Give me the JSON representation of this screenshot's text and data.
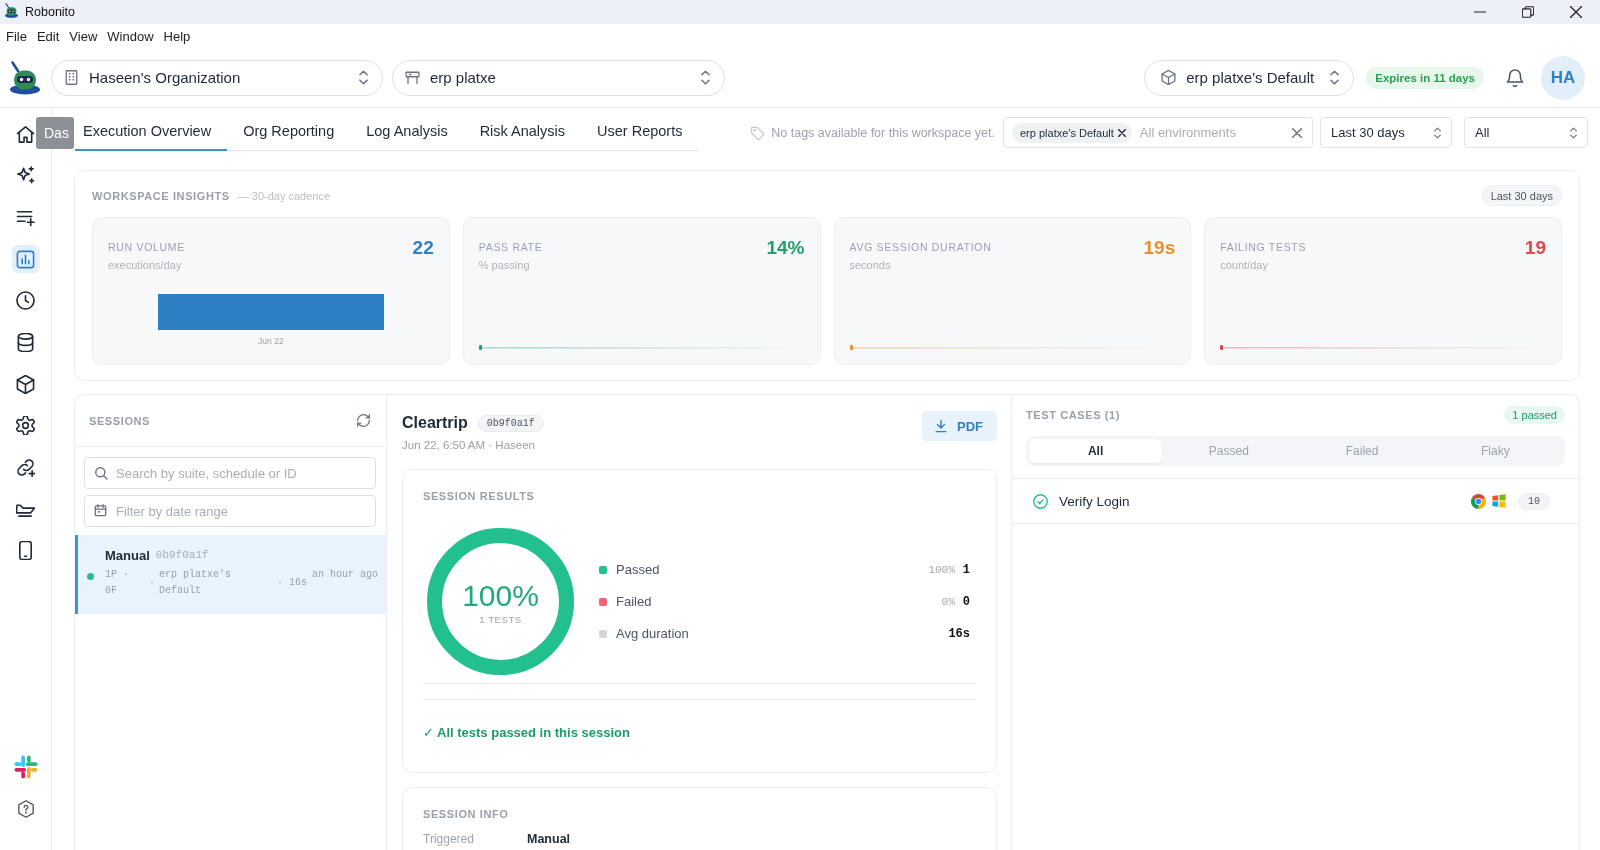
{
  "window": {
    "title": "Robonito"
  },
  "menu": [
    "File",
    "Edit",
    "View",
    "Window",
    "Help"
  ],
  "header": {
    "organization": "Haseen's Organization",
    "project": "erp platxe",
    "environment": "erp platxe's Default",
    "expiry": "Expires in 11 days",
    "avatar": "HA"
  },
  "sidebar": {
    "items": [
      {
        "selected": false
      },
      {
        "selected": false
      },
      {
        "selected": false
      },
      {
        "selected": true
      },
      {
        "selected": false
      },
      {
        "selected": false
      },
      {
        "selected": false
      },
      {
        "selected": false
      },
      {
        "selected": false
      },
      {
        "selected": false
      },
      {
        "selected": false
      }
    ]
  },
  "tooltip": "Das",
  "tabs": [
    {
      "label": "Execution Overview",
      "selected": true
    },
    {
      "label": "Org Reporting",
      "selected": false
    },
    {
      "label": "Log Analysis",
      "selected": false
    },
    {
      "label": "Risk Analysis",
      "selected": false
    },
    {
      "label": "User Reports",
      "selected": false
    }
  ],
  "filters": {
    "tags_note": "No tags available for this workspace yet.",
    "environment_chip": "erp platxe's Default",
    "environment_placeholder": "All environments",
    "date_range": "Last 30 days",
    "status": "All"
  },
  "insights": {
    "title": "WORKSPACE INSIGHTS",
    "subtitle": "— 30-day cadence",
    "range": "Last 30 days",
    "cards": [
      {
        "kind": "bar",
        "label": "RUN VOLUME",
        "unit": "executions/day",
        "value": "22",
        "color": "#2f7fc4",
        "axis_label": "Jun 22"
      },
      {
        "kind": "line",
        "label": "PASS RATE",
        "unit": "% passing",
        "value": "14%",
        "color": "#22a06b"
      },
      {
        "kind": "line",
        "label": "AVG SESSION DURATION",
        "unit": "seconds",
        "value": "19s",
        "color": "#e8912d"
      },
      {
        "kind": "line",
        "label": "FAILING TESTS",
        "unit": "count/day",
        "value": "19",
        "color": "#dc4a4a"
      }
    ]
  },
  "sessions": {
    "title": "SESSIONS",
    "search_placeholder": "Search by suite, schedule or ID",
    "date_placeholder": "Filter by date range",
    "items": [
      {
        "selected": true,
        "passed": true,
        "name": "Manual",
        "id": "0b9f0a1f",
        "meta": [
          "1P · 0F",
          "·",
          "erp platxe's Default",
          "· 16s"
        ],
        "time": "an hour ago"
      }
    ]
  },
  "session": {
    "title": "Cleartrip",
    "id": "0b9f0a1f",
    "subtitle": "Jun 22, 6:50 AM · Haseen",
    "export_label": "PDF",
    "results": {
      "title": "SESSION RESULTS",
      "ring": {
        "level": 1,
        "value": "100%",
        "caption": "1 TESTS"
      },
      "legend": [
        {
          "label": "Passed",
          "color": "#22c08f",
          "percent": "100%",
          "count": "1"
        },
        {
          "label": "Failed",
          "color": "#f06373",
          "percent": "0%",
          "count": "0"
        },
        {
          "label": "Avg duration",
          "color": "#d1d5db",
          "count": "16s"
        }
      ],
      "summary": "✓ All tests passed in this session"
    },
    "info": {
      "title": "SESSION INFO",
      "rows": [
        {
          "label": "Triggered",
          "value": "Manual"
        }
      ]
    }
  },
  "test_cases": {
    "title": "TEST CASES (1)",
    "badge": "1 passed",
    "filters": [
      {
        "label": "All",
        "selected": true
      },
      {
        "label": "Passed",
        "selected": false
      },
      {
        "label": "Failed",
        "selected": false
      },
      {
        "label": "Flaky",
        "selected": false
      }
    ],
    "items": [
      {
        "name": "Verify Login",
        "passed": true,
        "count": "10"
      }
    ]
  }
}
